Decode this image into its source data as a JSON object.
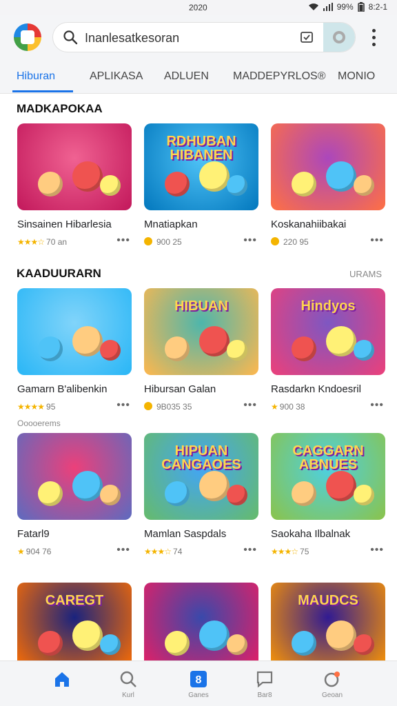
{
  "status": {
    "time": "2020",
    "battery": "99%",
    "clock": "8:2-1"
  },
  "search": {
    "value": "Inanlesatkesoran"
  },
  "tabs": [
    {
      "label": "Hiburan",
      "active": true
    },
    {
      "label": "APLIKASA"
    },
    {
      "label": "ADLUEN"
    },
    {
      "label": "MADDEPYRLOS®"
    },
    {
      "label": "MONIO"
    }
  ],
  "sections": [
    {
      "title": "MADKAPOKAA"
    },
    {
      "title": "KAADUURARN",
      "more": "URAMS"
    }
  ],
  "cards": [
    {
      "title": "Sinsainen Hibarlesia",
      "rating": "★★★☆",
      "meta": "70 an",
      "thumb_title": "",
      "colors": [
        "#f06292",
        "#c2185b"
      ]
    },
    {
      "title": "Mnatiapkan",
      "rating": "",
      "meta": "900 25",
      "thumb_title": "RDHUBAN HIBANEN",
      "colors": [
        "#4fc3f7",
        "#0277bd"
      ]
    },
    {
      "title": "Koskanahiibakai",
      "rating": "",
      "meta": "220 95",
      "thumb_title": "",
      "colors": [
        "#ab47bc",
        "#ff7043"
      ]
    },
    {
      "title": "Gamarn B'alibenkin",
      "rating": "★★★★",
      "meta": "95",
      "sub": "Ooooerems",
      "thumb_title": "",
      "colors": [
        "#81d4fa",
        "#29b6f6"
      ]
    },
    {
      "title": "Hibursan Galan",
      "rating": "",
      "meta": "9B035 35",
      "thumb_title": "HIBUAN",
      "colors": [
        "#4db6ac",
        "#ffb74d"
      ]
    },
    {
      "title": "Rasdarkn Kndoesril",
      "rating": "★",
      "meta": "900 38",
      "thumb_title": "Hindyos",
      "colors": [
        "#7e57c2",
        "#ec407a"
      ]
    },
    {
      "title": "Fatarl9",
      "rating": "★",
      "meta": "904 76",
      "thumb_title": "",
      "colors": [
        "#ec407a",
        "#5c6bc0"
      ]
    },
    {
      "title": "Mamlan Saspdals",
      "rating": "★★★☆",
      "meta": "74",
      "thumb_title": "HIPUAN CANGAOES",
      "colors": [
        "#42a5f5",
        "#66bb6a"
      ]
    },
    {
      "title": "Saokaha Ilbalnak",
      "rating": "★★★☆",
      "meta": "75",
      "thumb_title": "CAGGARN ABNUES",
      "colors": [
        "#4dd0e1",
        "#8bc34a"
      ]
    },
    {
      "title": "",
      "rating": "",
      "meta": "",
      "thumb_title": "CAREGT",
      "colors": [
        "#1a237e",
        "#ff6f00"
      ]
    },
    {
      "title": "",
      "rating": "",
      "meta": "",
      "thumb_title": "",
      "colors": [
        "#3949ab",
        "#e91e63"
      ]
    },
    {
      "title": "",
      "rating": "",
      "meta": "",
      "thumb_title": "MAUDCS",
      "colors": [
        "#311b92",
        "#ff9800"
      ]
    }
  ],
  "nav": [
    {
      "label": "",
      "icon": "home-icon",
      "active": true
    },
    {
      "label": "Kurl",
      "icon": "search-icon"
    },
    {
      "label": "Ganes",
      "icon": "games-icon"
    },
    {
      "label": "Bar8",
      "icon": "chat-icon"
    },
    {
      "label": "Geoan",
      "icon": "account-icon"
    }
  ],
  "accent": "#1a73e8"
}
